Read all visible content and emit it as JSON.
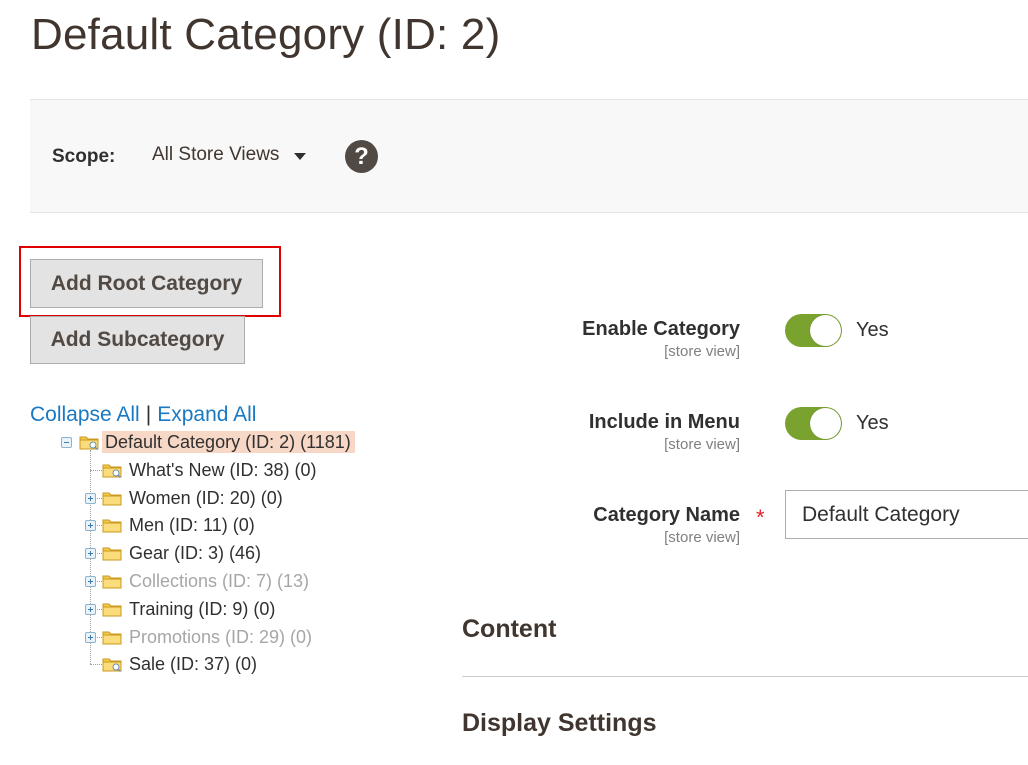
{
  "page": {
    "title": "Default Category (ID: 2)"
  },
  "scope": {
    "label": "Scope:",
    "selected": "All Store Views",
    "help_icon": "?"
  },
  "buttons": {
    "add_root": "Add Root Category",
    "add_sub": "Add Subcategory"
  },
  "tree_controls": {
    "collapse": "Collapse All",
    "separator": "|",
    "expand": "Expand All"
  },
  "tree": {
    "root": {
      "label": "Default Category (ID: 2) (1181)",
      "selected": true,
      "expanded": true
    },
    "children": [
      {
        "label": "What's New (ID: 38) (0)",
        "enabled": true,
        "has_children": false
      },
      {
        "label": "Women (ID: 20) (0)",
        "enabled": true,
        "has_children": true
      },
      {
        "label": "Men (ID: 11) (0)",
        "enabled": true,
        "has_children": true
      },
      {
        "label": "Gear (ID: 3) (46)",
        "enabled": true,
        "has_children": true
      },
      {
        "label": "Collections (ID: 7) (13)",
        "enabled": false,
        "has_children": true
      },
      {
        "label": "Training (ID: 9) (0)",
        "enabled": true,
        "has_children": true
      },
      {
        "label": "Promotions (ID: 29) (0)",
        "enabled": false,
        "has_children": true
      },
      {
        "label": "Sale (ID: 37) (0)",
        "enabled": true,
        "has_children": false
      }
    ]
  },
  "form": {
    "enable_category": {
      "label": "Enable Category",
      "scope": "[store view]",
      "value": "Yes",
      "on": true
    },
    "include_in_menu": {
      "label": "Include in Menu",
      "scope": "[store view]",
      "value": "Yes",
      "on": true
    },
    "category_name": {
      "label": "Category Name",
      "scope": "[store view]",
      "required_mark": "*",
      "value": "Default Category"
    }
  },
  "sections": {
    "content": "Content",
    "display_settings": "Display Settings"
  },
  "colors": {
    "toggle_on": "#79a22e",
    "link": "#1979c3",
    "highlight": "#e00000",
    "selected_node": "#f7d7c6",
    "required": "#e22626"
  }
}
